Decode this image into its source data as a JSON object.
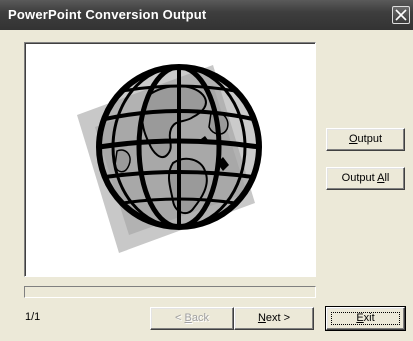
{
  "window": {
    "title": "PowerPoint Conversion Output"
  },
  "buttons": {
    "output": {
      "accel": "O",
      "rest": "utput"
    },
    "output_all": {
      "pre": "Output ",
      "accel": "A",
      "rest": "ll"
    },
    "back": {
      "pre": "< ",
      "accel": "B",
      "rest": "ack"
    },
    "next": {
      "accel": "N",
      "rest": "ext >"
    },
    "exit": {
      "accel": "E",
      "rest": "xit"
    }
  },
  "status": {
    "page_counter": "1/1",
    "progress_fraction": 0
  },
  "icons": {
    "close": "close-icon",
    "slide_image": "globe-icon"
  },
  "colors": {
    "titlebar": "#3e3e3e",
    "background": "#ece9d8",
    "disabled_text": "#a0a0a0"
  }
}
